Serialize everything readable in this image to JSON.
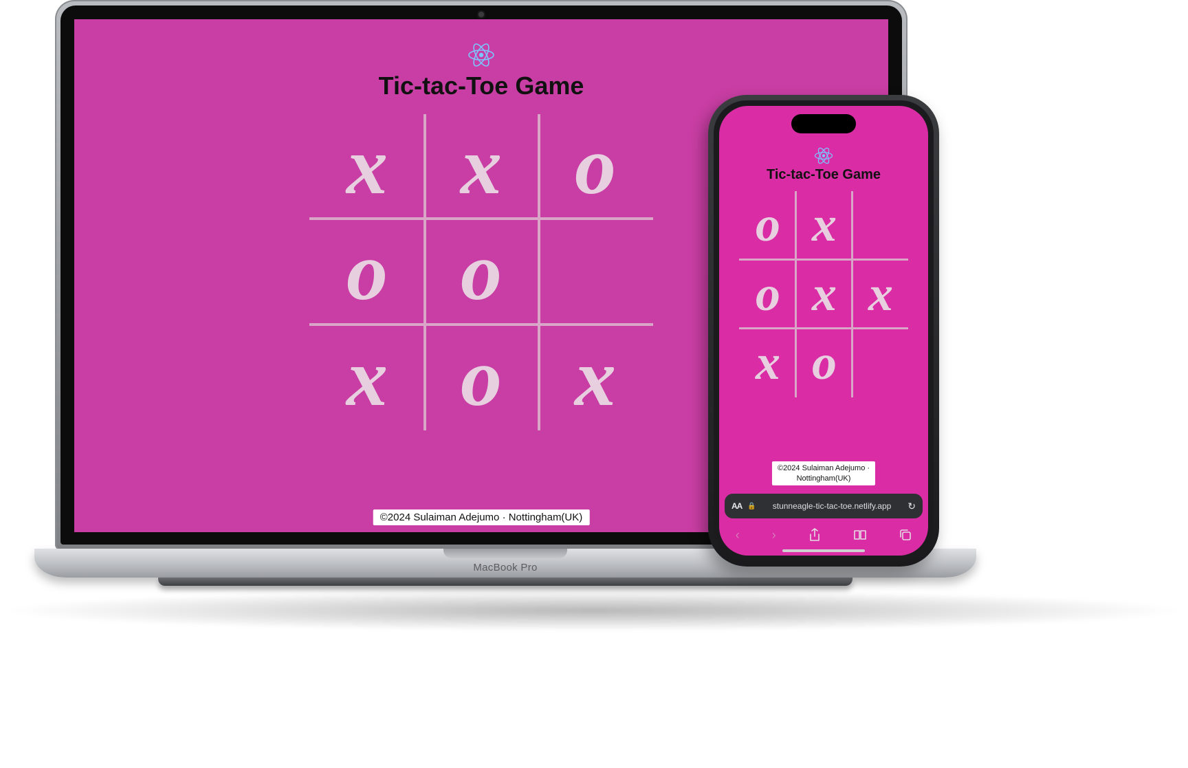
{
  "colors": {
    "background_laptop": "#c93ea4",
    "background_phone": "#da2ca4",
    "grid_line": "#d9a6c8",
    "mark": "#e8cfe0",
    "react_icon": "#7cc5ff"
  },
  "laptop": {
    "device_label": "MacBook Pro",
    "game": {
      "title": "Tic-tac-Toe Game",
      "board": [
        "x",
        "x",
        "o",
        "o",
        "o",
        "",
        "x",
        "o",
        "x"
      ],
      "footer": "©2024 Sulaiman Adejumo · Nottingham(UK)"
    }
  },
  "phone": {
    "game": {
      "title": "Tic-tac-Toe Game",
      "board": [
        "o",
        "x",
        "",
        "o",
        "x",
        "x",
        "x",
        "o",
        ""
      ],
      "footer_line1": "©2024 Sulaiman Adejumo ·",
      "footer_line2": "Nottingham(UK)"
    },
    "safari": {
      "aa_label": "AA",
      "url": "stunneagle-tic-tac-toe.netlify.app"
    }
  }
}
